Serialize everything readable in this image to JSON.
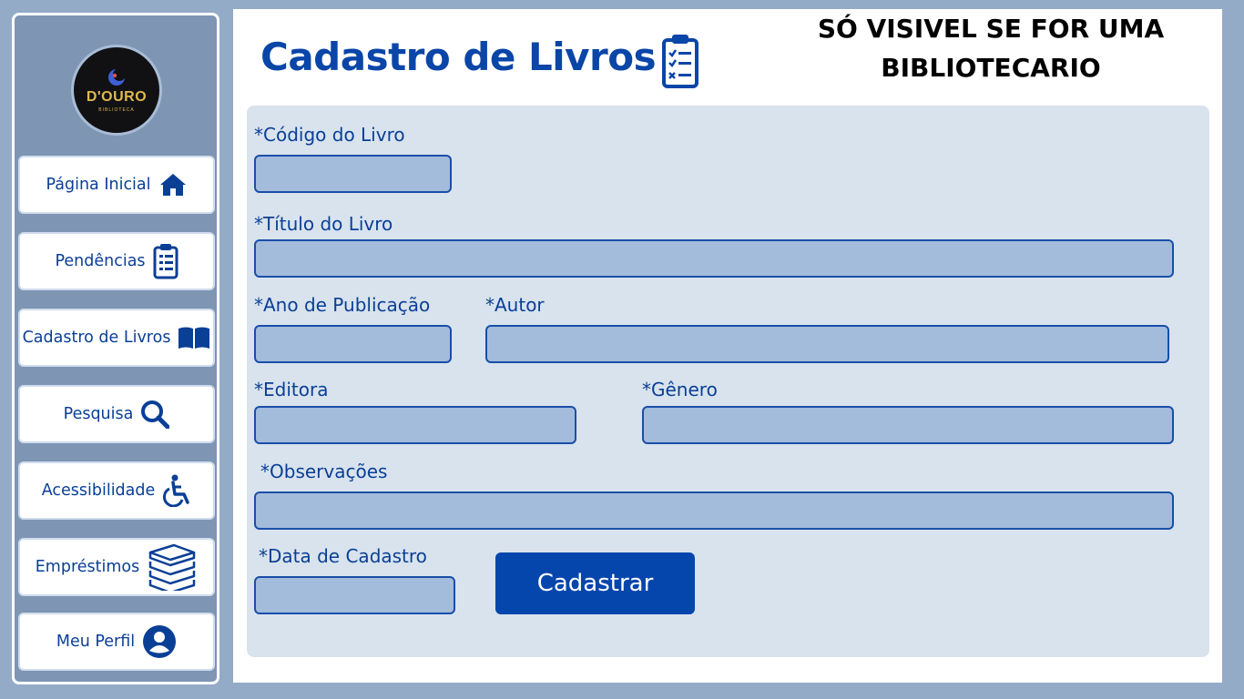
{
  "brand": {
    "name": "D'OURO",
    "subtitle": "BIBLIOTECA"
  },
  "sidebar": {
    "items": [
      {
        "label": "Página Inicial",
        "icon": "home-icon"
      },
      {
        "label": "Pendências",
        "icon": "clipboard-icon"
      },
      {
        "label": "Cadastro de Livros",
        "icon": "book-open-icon"
      },
      {
        "label": "Pesquisa",
        "icon": "search-icon"
      },
      {
        "label": "Acessibilidade",
        "icon": "wheelchair-icon"
      },
      {
        "label": "Empréstimos",
        "icon": "books-stack-icon"
      },
      {
        "label": "Meu Perfil",
        "icon": "user-icon"
      }
    ]
  },
  "header": {
    "title": "Cadastro de Livros",
    "title_icon": "clipboard-checklist-icon",
    "notice_line1": "SÓ VISIVEL SE FOR UMA",
    "notice_line2": "BIBLIOTECARIO"
  },
  "form": {
    "codigo": {
      "label": "*Código do Livro",
      "value": ""
    },
    "titulo": {
      "label": "*Título do Livro",
      "value": ""
    },
    "ano": {
      "label": "*Ano de Publicação",
      "value": ""
    },
    "autor": {
      "label": "*Autor",
      "value": ""
    },
    "editora": {
      "label": "*Editora",
      "value": ""
    },
    "genero": {
      "label": "*Gênero",
      "value": ""
    },
    "observacoes": {
      "label": "*Observações",
      "value": ""
    },
    "data_cadastro": {
      "label": "*Data de Cadastro",
      "value": ""
    },
    "submit_label": "Cadastrar"
  },
  "colors": {
    "accent": "#0a45a8",
    "button": "#0546ad",
    "field_bg": "#a3bcdc",
    "card_bg": "#d9e3ee",
    "sidebar_bg": "#7e95b4",
    "page_bg": "#94abc8"
  }
}
